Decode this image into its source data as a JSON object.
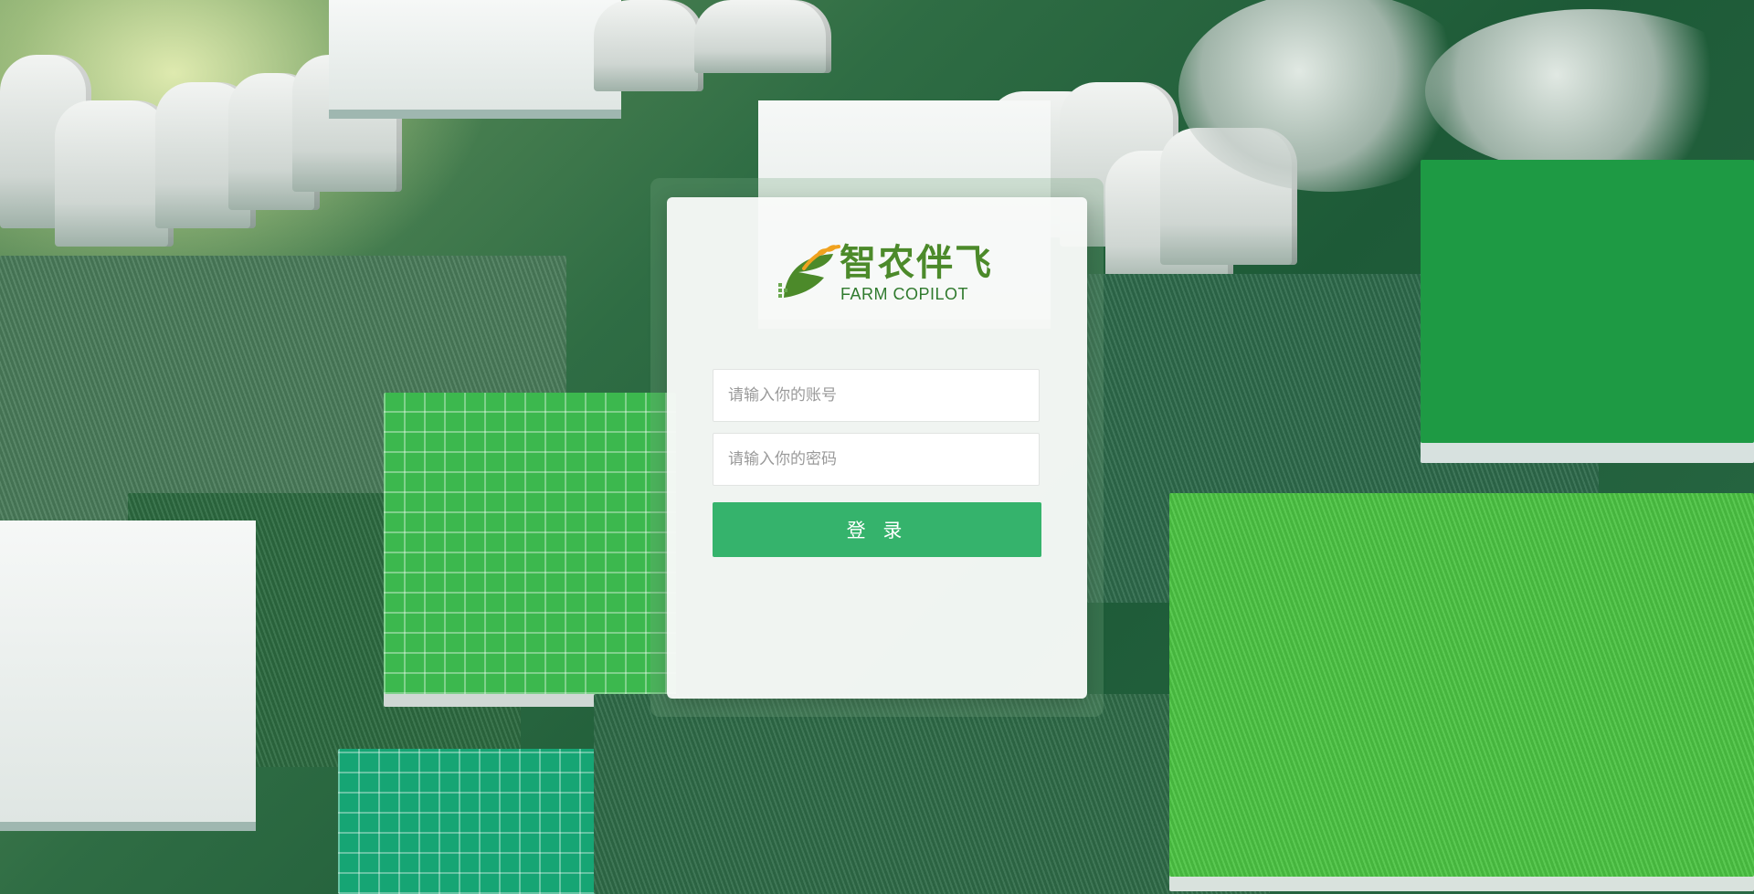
{
  "brand": {
    "name_cn": "智农伴飞",
    "name_en": "FARM COPILOT",
    "logo_icon": "leaf-wheat-logo-icon",
    "colors": {
      "logo_green": "#4c8a2a",
      "logo_orange": "#f0a21f"
    }
  },
  "login_form": {
    "account_placeholder": "请输入你的账号",
    "password_placeholder": "请输入你的密码",
    "account_value": "",
    "password_value": "",
    "submit_label": "登 录",
    "submit_color": "#35b36c"
  },
  "background": {
    "description_icon": "aerial-farm-greenhouses-background"
  }
}
